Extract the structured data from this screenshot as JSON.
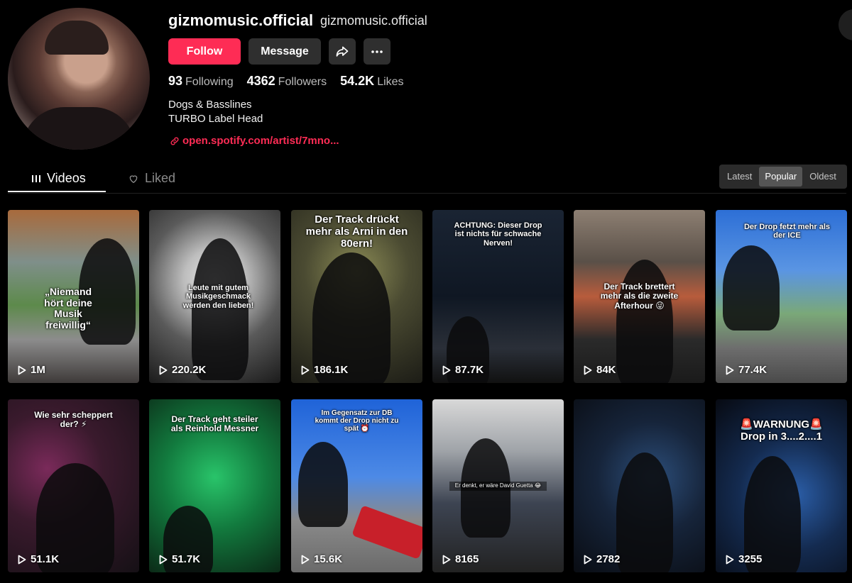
{
  "profile": {
    "username": "gizmomusic.official",
    "nickname": "gizmomusic.official",
    "buttons": {
      "follow": "Follow",
      "message": "Message"
    },
    "stats": [
      {
        "value": "93",
        "label": "Following"
      },
      {
        "value": "4362",
        "label": "Followers"
      },
      {
        "value": "54.2K",
        "label": "Likes"
      }
    ],
    "bio_line1": "Dogs & Basslines",
    "bio_line2": "TURBO Label Head",
    "link": "open.spotify.com/artist/7mno..."
  },
  "tabs": {
    "videos": "Videos",
    "liked": "Liked"
  },
  "sort": {
    "latest": "Latest",
    "popular": "Popular",
    "oldest": "Oldest",
    "selected": "Popular"
  },
  "videos": [
    {
      "caption": "„Niemand hört deine Musik freiwillig“",
      "views": "1M"
    },
    {
      "caption": "Leute mit gutem Musikgeschmack werden den lieben!",
      "views": "220.2K"
    },
    {
      "caption": "Der Track drückt mehr als Arni in den 80ern!",
      "views": "186.1K"
    },
    {
      "caption": "ACHTUNG: Dieser Drop ist nichts für schwache Nerven!",
      "views": "87.7K"
    },
    {
      "caption": "Der Track brettert mehr als die zweite Afterhour 😜",
      "views": "84K"
    },
    {
      "caption": "Der Drop fetzt mehr als der ICE",
      "views": "77.4K"
    },
    {
      "caption": "Wie sehr scheppert der? ⚡",
      "views": "51.1K"
    },
    {
      "caption": "Der Track geht steiler als Reinhold Messner",
      "views": "51.7K"
    },
    {
      "caption": "Im Gegensatz zur DB kommt der Drop nicht zu spät ⏰",
      "views": "15.6K"
    },
    {
      "caption": "Er denkt, er wäre David Guetta 😂",
      "views": "8165"
    },
    {
      "caption": "",
      "views": "2782"
    },
    {
      "caption": "🚨WARNUNG🚨 Drop in 3....2....1",
      "views": "3255"
    }
  ],
  "colors": {
    "accent": "#fe2c55",
    "background": "#000000",
    "button_dark": "#2f2f2f"
  },
  "icons": {
    "share": "share-arrow-icon",
    "more": "ellipsis-icon",
    "videos_tab": "grid-bars-icon",
    "liked_tab": "heart-outline-icon",
    "link": "link-icon",
    "play": "play-icon"
  }
}
